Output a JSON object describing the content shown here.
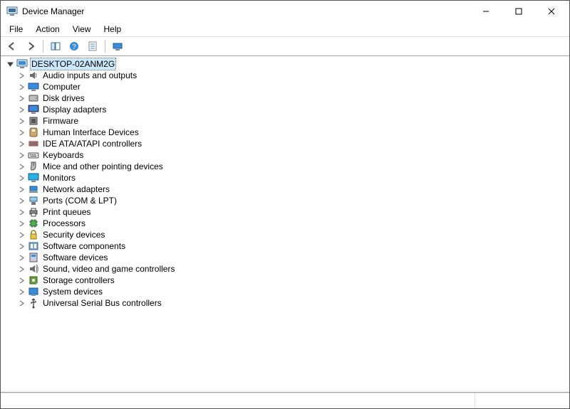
{
  "window": {
    "title": "Device Manager"
  },
  "menu": {
    "items": [
      "File",
      "Action",
      "View",
      "Help"
    ]
  },
  "tree": {
    "root": {
      "label": "DESKTOP-02ANM2G",
      "icon": "computer-node-icon",
      "expanded": true
    },
    "categories": [
      {
        "label": "Audio inputs and outputs",
        "icon": "audio-icon"
      },
      {
        "label": "Computer",
        "icon": "computer-icon"
      },
      {
        "label": "Disk drives",
        "icon": "disk-icon"
      },
      {
        "label": "Display adapters",
        "icon": "display-icon"
      },
      {
        "label": "Firmware",
        "icon": "firmware-icon"
      },
      {
        "label": "Human Interface Devices",
        "icon": "hid-icon"
      },
      {
        "label": "IDE ATA/ATAPI controllers",
        "icon": "ide-icon"
      },
      {
        "label": "Keyboards",
        "icon": "keyboard-icon"
      },
      {
        "label": "Mice and other pointing devices",
        "icon": "mouse-icon"
      },
      {
        "label": "Monitors",
        "icon": "monitor-icon"
      },
      {
        "label": "Network adapters",
        "icon": "network-icon"
      },
      {
        "label": "Ports (COM & LPT)",
        "icon": "ports-icon"
      },
      {
        "label": "Print queues",
        "icon": "printer-icon"
      },
      {
        "label": "Processors",
        "icon": "processor-icon"
      },
      {
        "label": "Security devices",
        "icon": "security-icon"
      },
      {
        "label": "Software components",
        "icon": "software-comp-icon"
      },
      {
        "label": "Software devices",
        "icon": "software-dev-icon"
      },
      {
        "label": "Sound, video and game controllers",
        "icon": "sound-icon"
      },
      {
        "label": "Storage controllers",
        "icon": "storage-icon"
      },
      {
        "label": "System devices",
        "icon": "system-icon"
      },
      {
        "label": "Universal Serial Bus controllers",
        "icon": "usb-icon"
      }
    ]
  }
}
